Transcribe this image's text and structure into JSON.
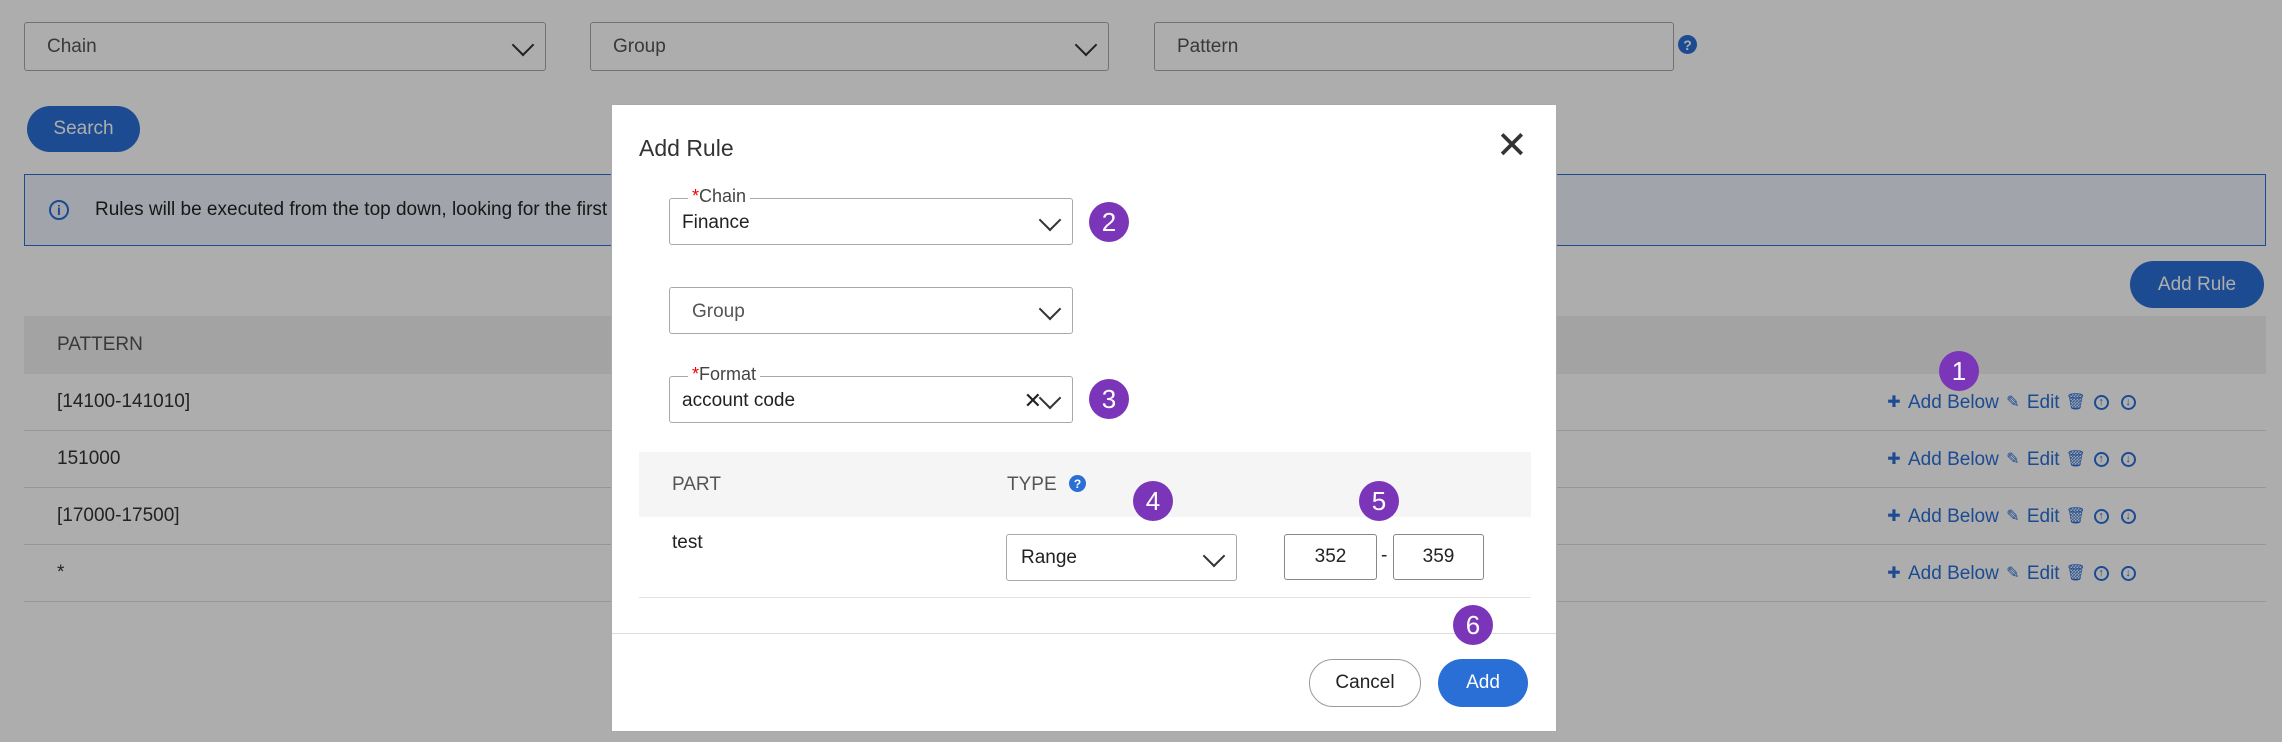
{
  "filters": {
    "chain_placeholder": "Chain",
    "group_placeholder": "Group",
    "pattern_placeholder": "Pattern",
    "help_glyph": "?"
  },
  "search_label": "Search",
  "info_text": "Rules will be executed from the top down, looking for the first",
  "add_rule_label": "Add Rule",
  "table": {
    "header": "PATTERN",
    "rows": [
      {
        "pattern": "[14100-141010]"
      },
      {
        "pattern": "151000"
      },
      {
        "pattern": "[17000-17500]"
      },
      {
        "pattern": "*"
      }
    ],
    "actions": {
      "add_below": "Add Below",
      "edit": "Edit"
    }
  },
  "modal": {
    "title": "Add Rule",
    "chain": {
      "legend": "Chain",
      "value": "Finance"
    },
    "group": {
      "placeholder": "Group"
    },
    "format": {
      "legend": "Format",
      "value": "account code"
    },
    "required_mark": "*",
    "part_header": "PART",
    "type_header": "TYPE",
    "part_row": {
      "part": "test",
      "type": "Range",
      "from": "352",
      "to": "359",
      "separator": "-"
    },
    "cancel_label": "Cancel",
    "add_label": "Add"
  },
  "badges": [
    "1",
    "2",
    "3",
    "4",
    "5",
    "6"
  ],
  "colors": {
    "accent": "#2a6fd6",
    "badge": "#7a35b8",
    "required": "#e00000"
  },
  "icons": [
    "chevron-down-icon",
    "help-icon",
    "info-icon",
    "plus-icon",
    "pencil-icon",
    "trash-icon",
    "arrow-up-icon",
    "arrow-down-icon",
    "close-icon",
    "clear-icon"
  ]
}
